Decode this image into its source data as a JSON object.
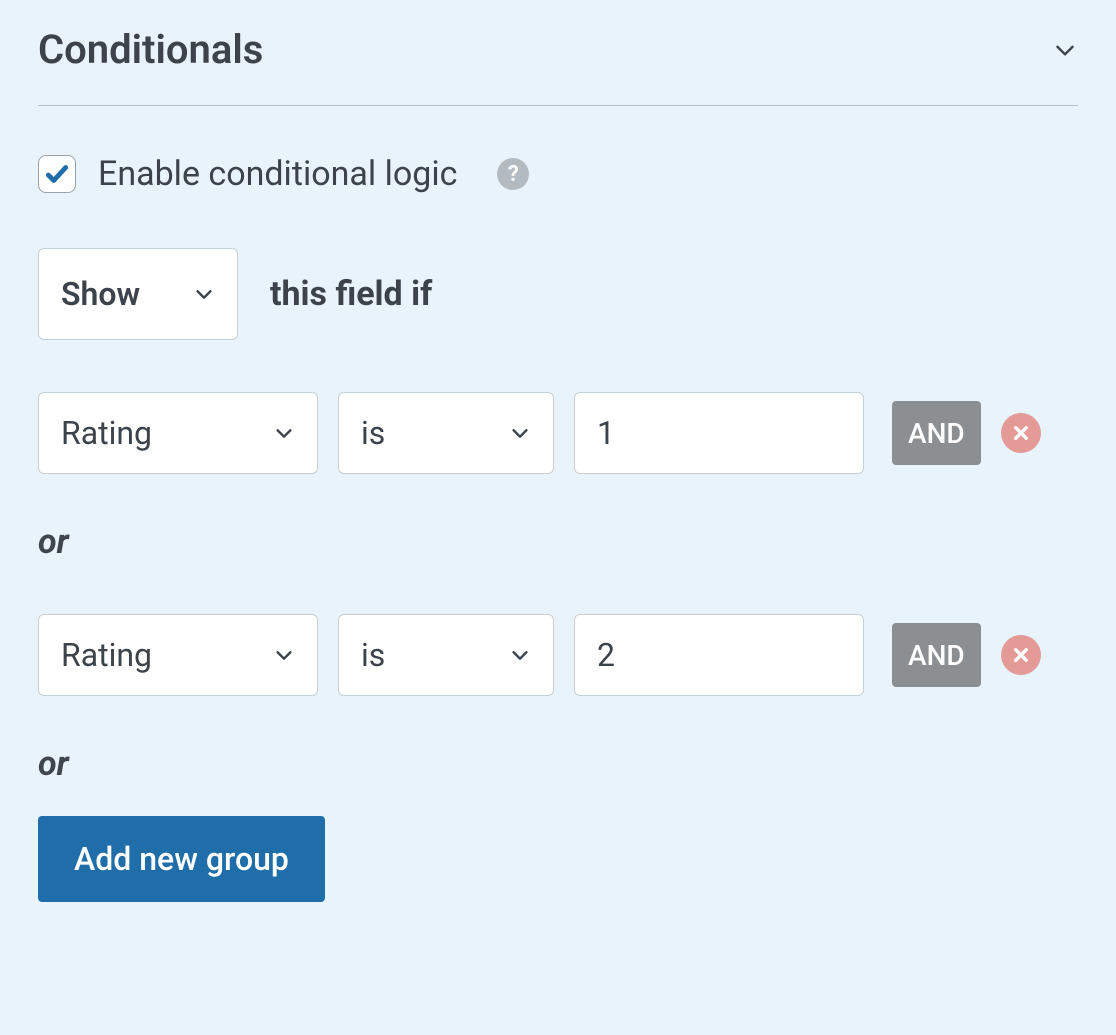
{
  "section": {
    "title": "Conditionals"
  },
  "enable": {
    "label": "Enable conditional logic",
    "checked": true
  },
  "action": {
    "selected": "Show",
    "suffix": "this field if"
  },
  "groups": [
    {
      "rules": [
        {
          "field": "Rating",
          "operator": "is",
          "value": "1"
        }
      ]
    },
    {
      "rules": [
        {
          "field": "Rating",
          "operator": "is",
          "value": "2"
        }
      ]
    }
  ],
  "labels": {
    "and": "AND",
    "or": "or",
    "add_group": "Add new group",
    "help_glyph": "?"
  }
}
